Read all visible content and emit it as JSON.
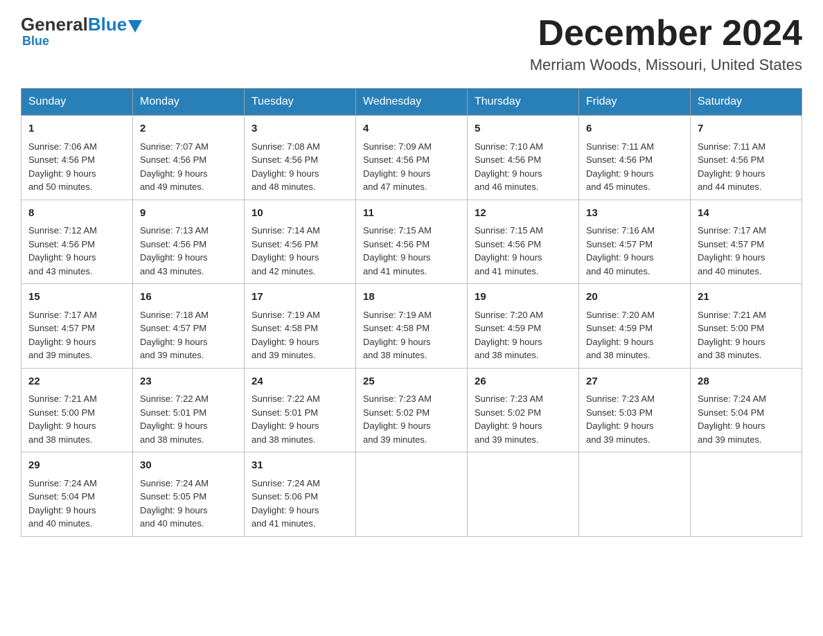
{
  "header": {
    "logo_general": "General",
    "logo_blue": "Blue",
    "month_title": "December 2024",
    "location": "Merriam Woods, Missouri, United States"
  },
  "days_of_week": [
    "Sunday",
    "Monday",
    "Tuesday",
    "Wednesday",
    "Thursday",
    "Friday",
    "Saturday"
  ],
  "weeks": [
    [
      {
        "day": "1",
        "sunrise": "7:06 AM",
        "sunset": "4:56 PM",
        "daylight": "9 hours and 50 minutes."
      },
      {
        "day": "2",
        "sunrise": "7:07 AM",
        "sunset": "4:56 PM",
        "daylight": "9 hours and 49 minutes."
      },
      {
        "day": "3",
        "sunrise": "7:08 AM",
        "sunset": "4:56 PM",
        "daylight": "9 hours and 48 minutes."
      },
      {
        "day": "4",
        "sunrise": "7:09 AM",
        "sunset": "4:56 PM",
        "daylight": "9 hours and 47 minutes."
      },
      {
        "day": "5",
        "sunrise": "7:10 AM",
        "sunset": "4:56 PM",
        "daylight": "9 hours and 46 minutes."
      },
      {
        "day": "6",
        "sunrise": "7:11 AM",
        "sunset": "4:56 PM",
        "daylight": "9 hours and 45 minutes."
      },
      {
        "day": "7",
        "sunrise": "7:11 AM",
        "sunset": "4:56 PM",
        "daylight": "9 hours and 44 minutes."
      }
    ],
    [
      {
        "day": "8",
        "sunrise": "7:12 AM",
        "sunset": "4:56 PM",
        "daylight": "9 hours and 43 minutes."
      },
      {
        "day": "9",
        "sunrise": "7:13 AM",
        "sunset": "4:56 PM",
        "daylight": "9 hours and 43 minutes."
      },
      {
        "day": "10",
        "sunrise": "7:14 AM",
        "sunset": "4:56 PM",
        "daylight": "9 hours and 42 minutes."
      },
      {
        "day": "11",
        "sunrise": "7:15 AM",
        "sunset": "4:56 PM",
        "daylight": "9 hours and 41 minutes."
      },
      {
        "day": "12",
        "sunrise": "7:15 AM",
        "sunset": "4:56 PM",
        "daylight": "9 hours and 41 minutes."
      },
      {
        "day": "13",
        "sunrise": "7:16 AM",
        "sunset": "4:57 PM",
        "daylight": "9 hours and 40 minutes."
      },
      {
        "day": "14",
        "sunrise": "7:17 AM",
        "sunset": "4:57 PM",
        "daylight": "9 hours and 40 minutes."
      }
    ],
    [
      {
        "day": "15",
        "sunrise": "7:17 AM",
        "sunset": "4:57 PM",
        "daylight": "9 hours and 39 minutes."
      },
      {
        "day": "16",
        "sunrise": "7:18 AM",
        "sunset": "4:57 PM",
        "daylight": "9 hours and 39 minutes."
      },
      {
        "day": "17",
        "sunrise": "7:19 AM",
        "sunset": "4:58 PM",
        "daylight": "9 hours and 39 minutes."
      },
      {
        "day": "18",
        "sunrise": "7:19 AM",
        "sunset": "4:58 PM",
        "daylight": "9 hours and 38 minutes."
      },
      {
        "day": "19",
        "sunrise": "7:20 AM",
        "sunset": "4:59 PM",
        "daylight": "9 hours and 38 minutes."
      },
      {
        "day": "20",
        "sunrise": "7:20 AM",
        "sunset": "4:59 PM",
        "daylight": "9 hours and 38 minutes."
      },
      {
        "day": "21",
        "sunrise": "7:21 AM",
        "sunset": "5:00 PM",
        "daylight": "9 hours and 38 minutes."
      }
    ],
    [
      {
        "day": "22",
        "sunrise": "7:21 AM",
        "sunset": "5:00 PM",
        "daylight": "9 hours and 38 minutes."
      },
      {
        "day": "23",
        "sunrise": "7:22 AM",
        "sunset": "5:01 PM",
        "daylight": "9 hours and 38 minutes."
      },
      {
        "day": "24",
        "sunrise": "7:22 AM",
        "sunset": "5:01 PM",
        "daylight": "9 hours and 38 minutes."
      },
      {
        "day": "25",
        "sunrise": "7:23 AM",
        "sunset": "5:02 PM",
        "daylight": "9 hours and 39 minutes."
      },
      {
        "day": "26",
        "sunrise": "7:23 AM",
        "sunset": "5:02 PM",
        "daylight": "9 hours and 39 minutes."
      },
      {
        "day": "27",
        "sunrise": "7:23 AM",
        "sunset": "5:03 PM",
        "daylight": "9 hours and 39 minutes."
      },
      {
        "day": "28",
        "sunrise": "7:24 AM",
        "sunset": "5:04 PM",
        "daylight": "9 hours and 39 minutes."
      }
    ],
    [
      {
        "day": "29",
        "sunrise": "7:24 AM",
        "sunset": "5:04 PM",
        "daylight": "9 hours and 40 minutes."
      },
      {
        "day": "30",
        "sunrise": "7:24 AM",
        "sunset": "5:05 PM",
        "daylight": "9 hours and 40 minutes."
      },
      {
        "day": "31",
        "sunrise": "7:24 AM",
        "sunset": "5:06 PM",
        "daylight": "9 hours and 41 minutes."
      },
      null,
      null,
      null,
      null
    ]
  ],
  "labels": {
    "sunrise_prefix": "Sunrise: ",
    "sunset_prefix": "Sunset: ",
    "daylight_prefix": "Daylight: "
  }
}
